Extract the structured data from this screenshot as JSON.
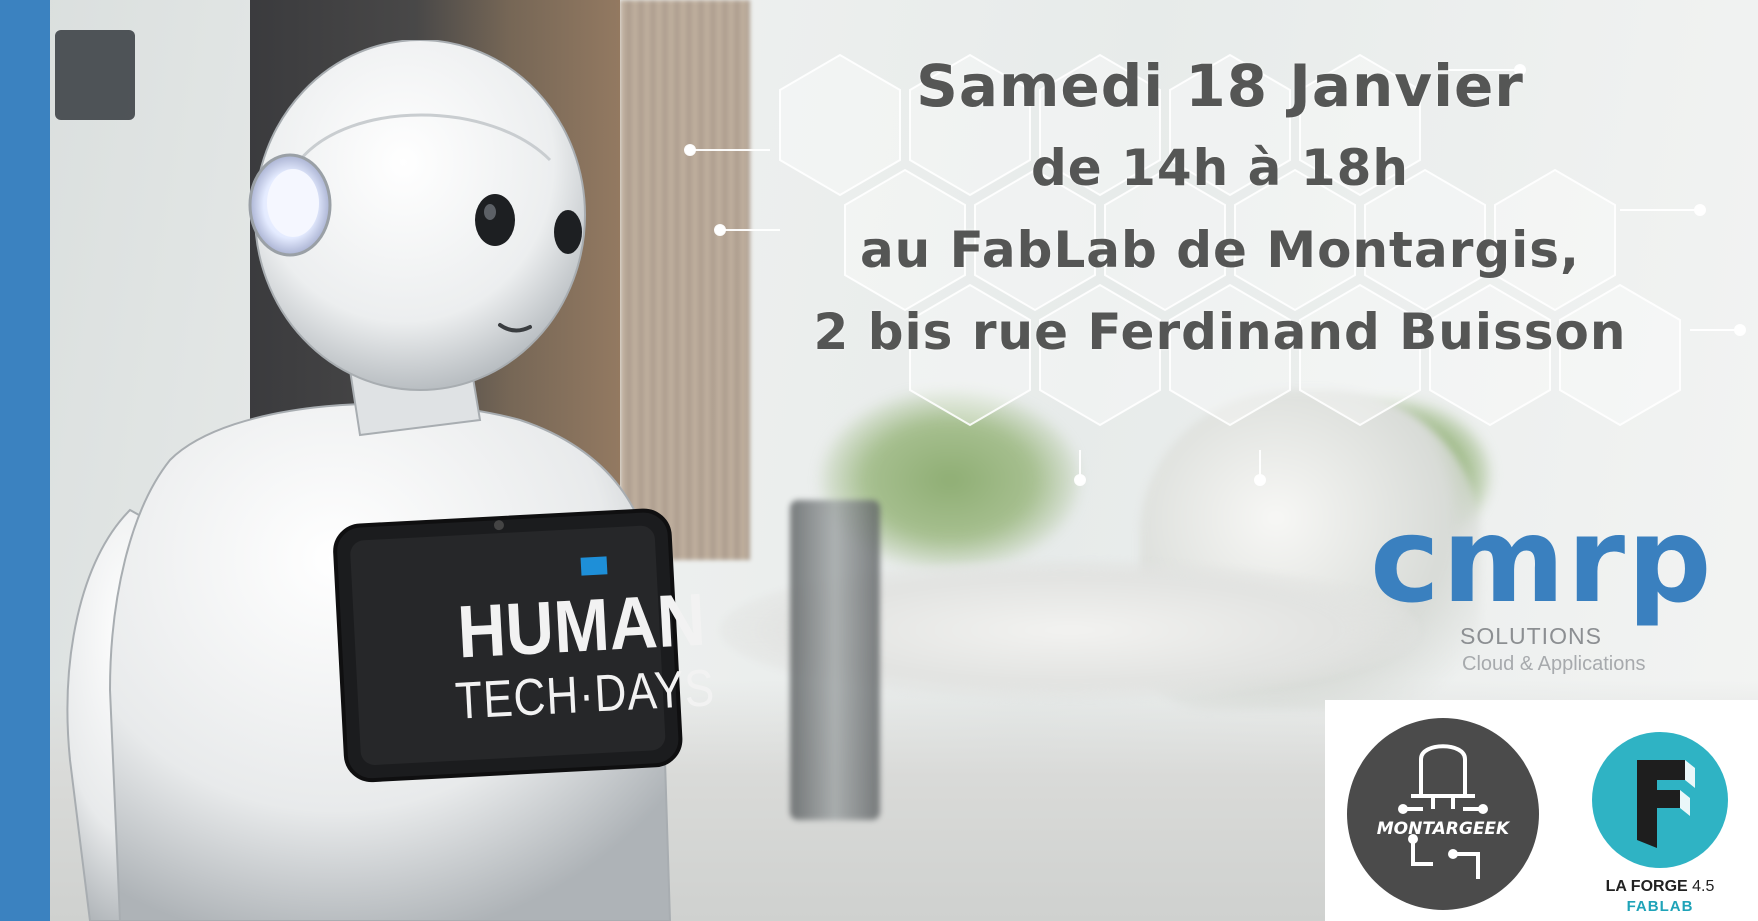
{
  "event": {
    "line1": "Samedi 18 Janvier",
    "line2": "de 14h à 18h",
    "line3": "au FabLab de Montargis,",
    "line4": "2 bis rue Ferdinand Buisson"
  },
  "tablet": {
    "title": "HUMAN",
    "subtitle": "TECH·DAYS"
  },
  "sponsors": {
    "cmrp": {
      "name": "cmrp",
      "subtitle": "SOLUTIONS",
      "tagline": "Cloud & Applications"
    },
    "montargeek": {
      "name": "MONTARGEEK"
    },
    "laforge": {
      "name": "LA FORGE",
      "version": "4.5",
      "sub": "FABLAB"
    }
  },
  "colors": {
    "accent_blue": "#3b82c0",
    "text_gray": "#555655",
    "teal": "#1fa3b8"
  }
}
